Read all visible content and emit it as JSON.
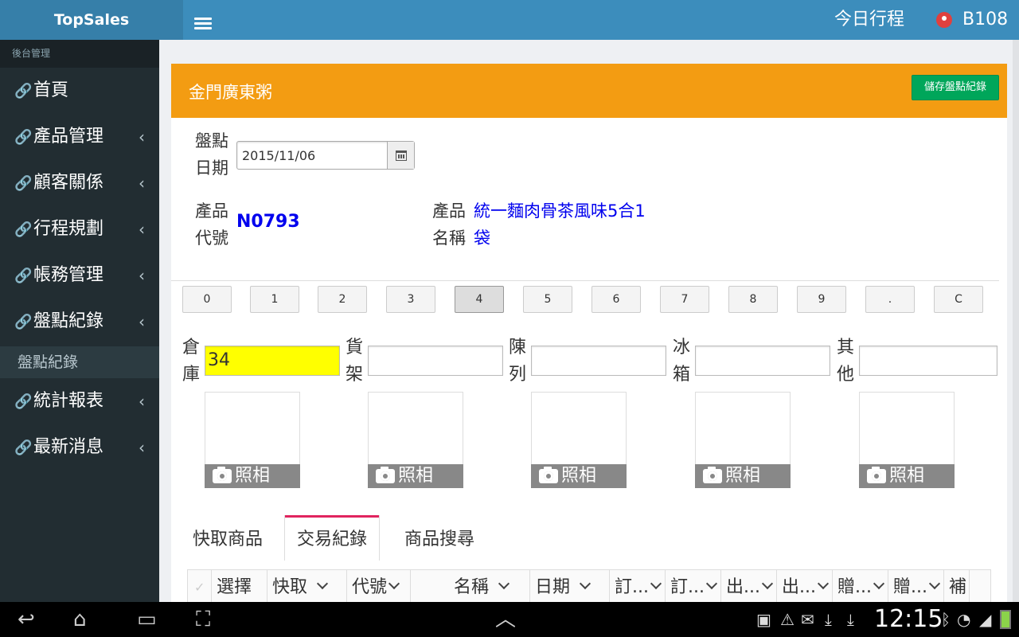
{
  "app": {
    "brand": "TopSales"
  },
  "topbar": {
    "schedule_label": "今日行程",
    "user_name": "B108"
  },
  "sidebar": {
    "header": "後台管理",
    "items": [
      {
        "label": "首頁",
        "has_children": false
      },
      {
        "label": "產品管理",
        "has_children": true
      },
      {
        "label": "顧客關係",
        "has_children": true
      },
      {
        "label": "行程規劃",
        "has_children": true
      },
      {
        "label": "帳務管理",
        "has_children": true
      },
      {
        "label": "盤點紀錄",
        "has_children": true
      },
      {
        "label": "統計報表",
        "has_children": true
      },
      {
        "label": "最新消息",
        "has_children": true
      }
    ],
    "active_subitem": "盤點紀錄"
  },
  "panel": {
    "title": "金門廣東粥",
    "save_label": "儲存盤點紀錄",
    "date_label_1": "盤點",
    "date_label_2": "日期",
    "date_value": "2015/11/06",
    "code_label_1": "產品",
    "code_label_2": "代號",
    "code_value": "N0793",
    "name_label_1": "產品",
    "name_label_2": "名稱",
    "name_value_1": "統一麵肉骨茶風味5合1",
    "name_value_2": "袋"
  },
  "keypad": {
    "keys": [
      "0",
      "1",
      "2",
      "3",
      "4",
      "5",
      "6",
      "7",
      "8",
      "9",
      ".",
      "C"
    ],
    "active_key": "4"
  },
  "stock_fields": [
    {
      "label_1": "倉",
      "label_2": "庫",
      "value": "34",
      "highlighted": true
    },
    {
      "label_1": "貨",
      "label_2": "架",
      "value": "",
      "highlighted": false
    },
    {
      "label_1": "陳",
      "label_2": "列",
      "value": "",
      "highlighted": false
    },
    {
      "label_1": "冰",
      "label_2": "箱",
      "value": "",
      "highlighted": false
    },
    {
      "label_1": "其",
      "label_2": "他",
      "value": "",
      "highlighted": false
    }
  ],
  "photo_button_label": "照相",
  "tabs": [
    {
      "label": "快取商品",
      "active": false
    },
    {
      "label": "交易紀錄",
      "active": true
    },
    {
      "label": "商品搜尋",
      "active": false
    }
  ],
  "grid_columns": [
    "選擇",
    "快取",
    "代號",
    "名稱",
    "日期",
    "訂...",
    "訂...",
    "出...",
    "出...",
    "贈...",
    "贈...",
    "補"
  ],
  "system_bar": {
    "clock": "12:15"
  },
  "colors": {
    "topbar": "#3c8dbc",
    "sidebar": "#222d32",
    "panel_header": "#f39c12",
    "save_button": "#00a65a",
    "highlight": "#ffff00",
    "link_blue": "#0000ee",
    "active_tab": "#e0245e"
  }
}
